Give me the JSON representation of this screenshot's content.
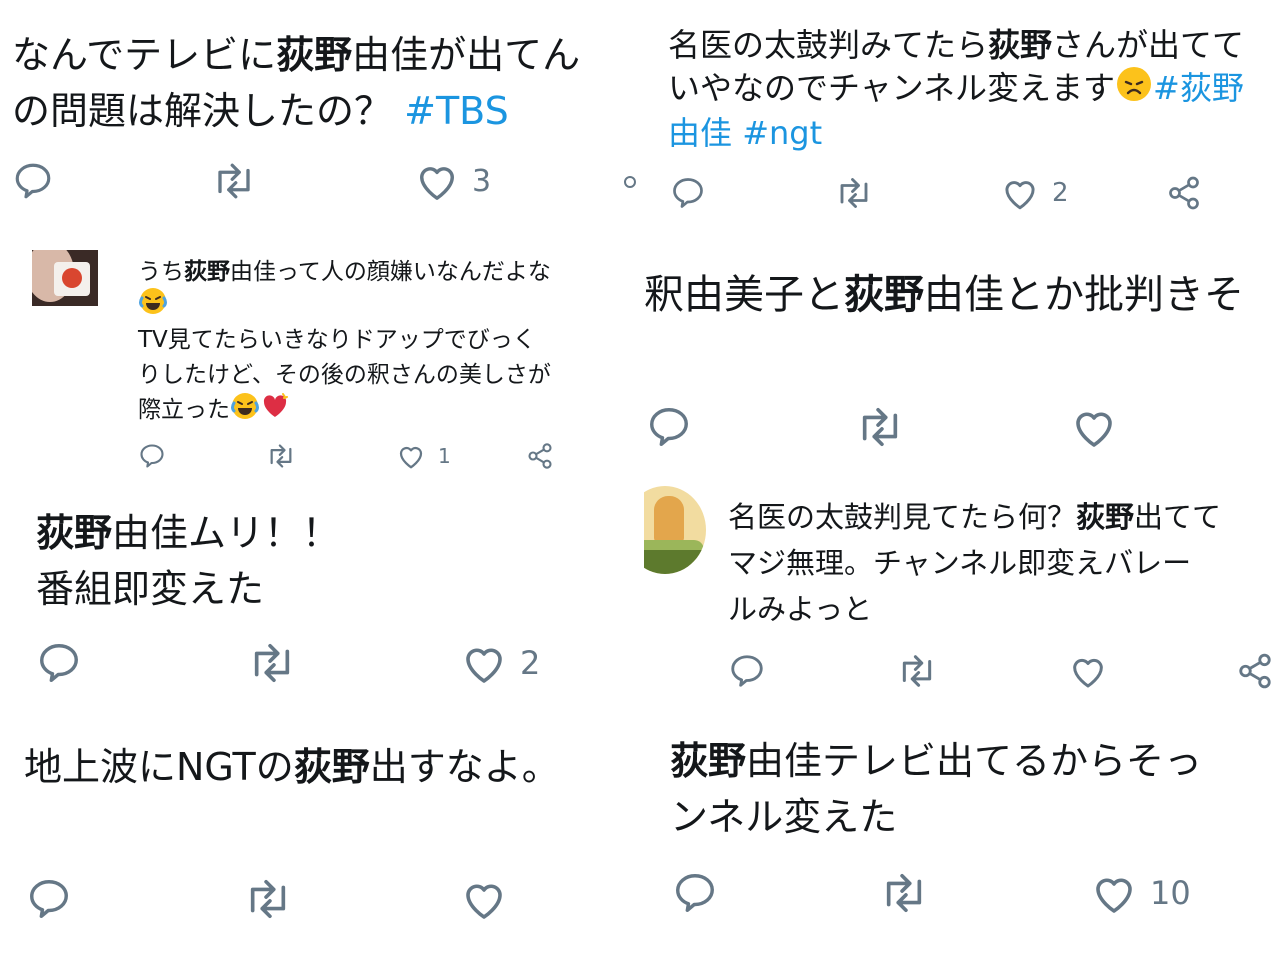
{
  "tiles": {
    "t1": {
      "line1_pre": "なんでテレビに",
      "line1_bold": "荻野",
      "line1_post": "由佳が出てん",
      "line2": "の問題は解決したの？",
      "hashtag": "#TBS",
      "like_count": "3"
    },
    "t2": {
      "line1_pre": "名医の太鼓判みてたら",
      "line1_bold": "荻野",
      "line1_post": "さんが出てて",
      "line2": "いやなのでチャンネル変えます",
      "hashtag1": "#荻野",
      "line3_hashtag_cont": "由佳",
      "hashtag2": "#ngt",
      "like_count": "2"
    },
    "t3": {
      "line1_pre": "うち",
      "line1_bold": "荻野",
      "line1_post": "由佳って人の顔嫌いなんだよな",
      "line3": "TV見てたらいきなりドアップでびっく",
      "line4": "りしたけど、その後の釈さんの美しさが",
      "line5": "際立った",
      "like_count": "1"
    },
    "t4": {
      "line_pre": "釈由美子と",
      "line_bold": "荻野",
      "line_post": "由佳とか批判きそ"
    },
    "t5": {
      "line1_bold": "荻野",
      "line1_post": "由佳ムリ！！",
      "line2": "番組即変えた",
      "like_count": "2"
    },
    "t6": {
      "line1_pre": "名医の太鼓判見てたら何？",
      "line1_bold": "荻野",
      "line1_post": "出てて",
      "line2": "マジ無理。チャンネル即変えバレー",
      "line3": "ルみよっと"
    },
    "t7": {
      "line_pre": "地上波にNGTの",
      "line_bold": "荻野",
      "line_post": "出すなよ。"
    },
    "t8": {
      "line1_bold": "荻野",
      "line1_post": "由佳テレビ出てるからそっ",
      "line2": "ンネル変えた",
      "like_count": "10"
    }
  },
  "icons": [
    "reply-icon",
    "retweet-icon",
    "like-icon",
    "share-icon",
    "sob-laugh-emoji",
    "disappointed-emoji",
    "heart-emoji"
  ],
  "colors": {
    "text": "#14171a",
    "hashtag": "#1b95e0",
    "action": "#657786"
  }
}
